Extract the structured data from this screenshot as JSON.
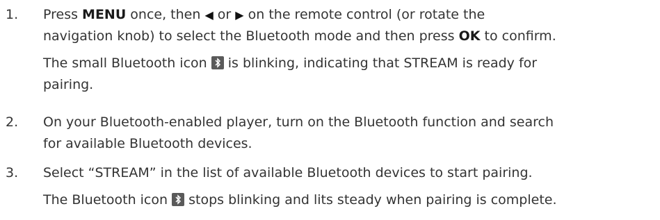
{
  "steps": [
    {
      "num": "1.",
      "line1_a": "Press ",
      "menu": "MENU",
      "line1_b": " once, then ",
      "left_arrow": "◀",
      "line1_c": " or ",
      "right_arrow": "▶",
      "line1_d": " on the remote control (or rotate the",
      "line2_a": "navigation knob) to select the Bluetooth mode and then press ",
      "ok": "OK",
      "line2_b": " to confirm.",
      "line3_a": "The small Bluetooth icon ",
      "line3_b": " is blinking, indicating that STREAM is ready for",
      "line4": "pairing."
    },
    {
      "num": "2.",
      "line1": "On your Bluetooth-enabled player, turn on the Bluetooth function and search",
      "line2": "for available Bluetooth devices."
    },
    {
      "num": "3.",
      "line1": "Select “STREAM” in the list of available Bluetooth devices to start pairing.",
      "line2_a": "The Bluetooth icon ",
      "line2_b": " stops blinking and lits steady when pairing is complete."
    }
  ],
  "icons": {
    "bluetooth": "bluetooth-icon"
  },
  "colors": {
    "text": "#333333",
    "icon_bg": "#5a5a5a"
  }
}
